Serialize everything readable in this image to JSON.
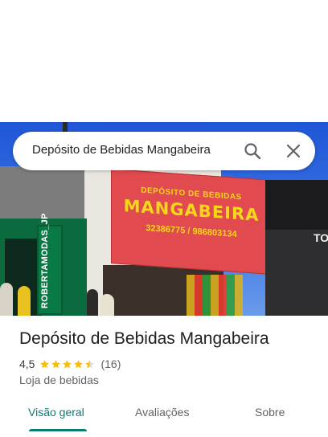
{
  "search": {
    "query": "Depósito de Bebidas Mangabeira"
  },
  "photo": {
    "sign_line1": "DEPÓSITO DE BEBIDAS",
    "sign_line2": "MANGABEIRA",
    "sign_line3": "32386775 / 986803134",
    "store_sign": "ROBERTAMODAS_JP",
    "right_sign": "TO"
  },
  "place": {
    "title": "Depósito de Bebidas Mangabeira",
    "rating": "4,5",
    "stars": 4.5,
    "review_count": "(16)",
    "category": "Loja de bebidas"
  },
  "tabs": [
    {
      "label": "Visão geral",
      "active": true
    },
    {
      "label": "Avaliações",
      "active": false
    },
    {
      "label": "Sobre",
      "active": false
    }
  ],
  "colors": {
    "accent": "#0b7a73",
    "star": "#fbbc04",
    "sign_red": "#e14a4e",
    "sign_text": "#f6d71a"
  },
  "icons": [
    "search-icon",
    "close-icon",
    "star-icon"
  ]
}
